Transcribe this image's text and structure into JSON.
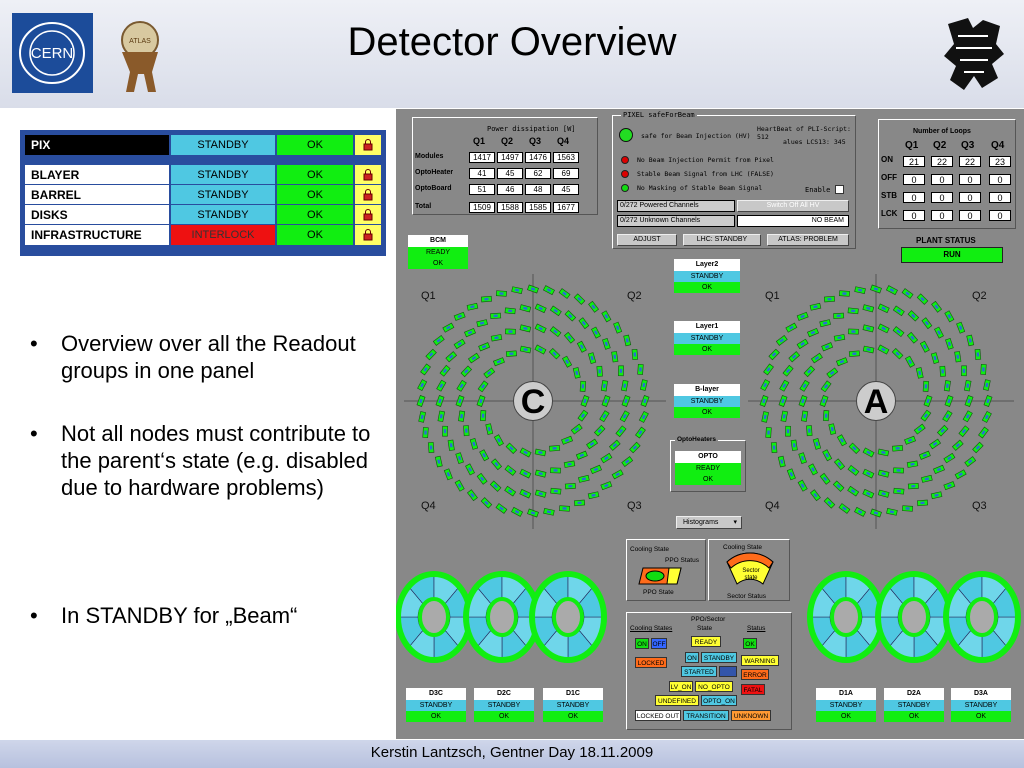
{
  "header": {
    "title": "Detector Overview",
    "cern_logo_text": "CERN",
    "atlas_logo_text": "ATLAS"
  },
  "footer": {
    "text": "Kerstin Lantzsch, Gentner Day 18.11.2009"
  },
  "status_table": {
    "rows": [
      {
        "name": "PIX",
        "state": "STANDBY",
        "status": "OK",
        "lock": "lock-icon"
      },
      {
        "name": "BLAYER",
        "state": "STANDBY",
        "status": "OK",
        "lock": "lock-icon"
      },
      {
        "name": "BARREL",
        "state": "STANDBY",
        "status": "OK",
        "lock": "lock-icon"
      },
      {
        "name": "DISKS",
        "state": "STANDBY",
        "status": "OK",
        "lock": "lock-icon"
      },
      {
        "name": "INFRASTRUCTURE",
        "state": "INTERLOCK",
        "status": "OK",
        "lock": "lock-icon"
      }
    ],
    "colors": {
      "border": "#294d9e",
      "standby": "#4fc8e2",
      "ok": "#11ee11",
      "interlock": "#ee1111",
      "lock": "#ffff66"
    }
  },
  "bullets": [
    "Overview over all the Readout groups in one panel",
    "Not all nodes must contribute to the parent‘s state (e.g. disabled due to hardware problems)",
    "In STANDBY for „Beam“"
  ],
  "power": {
    "title": "Power dissipation [W]",
    "cols": [
      "Q1",
      "Q2",
      "Q3",
      "Q4"
    ],
    "rows": [
      {
        "label": "Modules",
        "values": [
          "1417",
          "1497",
          "1476",
          "1563"
        ]
      },
      {
        "label": "OptoHeater",
        "values": [
          "41",
          "45",
          "62",
          "69"
        ]
      },
      {
        "label": "OptoBoard",
        "values": [
          "51",
          "46",
          "48",
          "45"
        ]
      },
      {
        "label": "Total",
        "values": [
          "1509",
          "1588",
          "1585",
          "1677"
        ]
      }
    ]
  },
  "safe_for_beam": {
    "title": "PIXEL safeForBeam",
    "injection_label": "safe for Beam Injection (HV)",
    "heartbeat": "HeartBeat of PLI-Script: 512",
    "alues": "alues LCS13:  345",
    "signals": [
      {
        "text": "No Beam Injection Permit from Pixel",
        "color": "#dd0000"
      },
      {
        "text": "Stable Beam Signal from LHC (FALSE)",
        "color": "#dd0000"
      },
      {
        "text": "No Masking of Stable Beam Signal",
        "color": "#11dd11"
      }
    ],
    "enable_label": "Enable",
    "powered": "0/272 Powered Channels",
    "unknown": "0/272 Unknown Channels",
    "switch_off": "Switch Off All HV",
    "no_beam": "NO BEAM",
    "buttons": [
      "ADJUST",
      "LHC: STANDBY",
      "ATLAS: PROBLEM"
    ]
  },
  "loops": {
    "title": "Number of Loops",
    "cols": [
      "Q1",
      "Q2",
      "Q3",
      "Q4"
    ],
    "rows": [
      {
        "label": "ON",
        "values": [
          "21",
          "22",
          "22",
          "23"
        ]
      },
      {
        "label": "OFF",
        "values": [
          "0",
          "0",
          "0",
          "0"
        ]
      },
      {
        "label": "STB",
        "values": [
          "0",
          "0",
          "0",
          "0"
        ]
      },
      {
        "label": "LCK",
        "values": [
          "0",
          "0",
          "0",
          "0"
        ]
      }
    ]
  },
  "plant": {
    "title": "PLANT STATUS",
    "value": "RUN"
  },
  "bcm": {
    "title": "BCM",
    "state": "READY",
    "status": "OK"
  },
  "layers": [
    {
      "title": "Layer2",
      "state": "STANDBY",
      "status": "OK"
    },
    {
      "title": "Layer1",
      "state": "STANDBY",
      "status": "OK"
    },
    {
      "title": "B-layer",
      "state": "STANDBY",
      "status": "OK"
    }
  ],
  "opto": {
    "group": "OptoHeaters",
    "title": "OPTO",
    "state": "READY",
    "status": "OK"
  },
  "histograms": "Histograms",
  "side_c": {
    "letter": "C",
    "quadrants": [
      "Q1",
      "Q2",
      "Q4",
      "Q3"
    ]
  },
  "side_a": {
    "letter": "A",
    "quadrants": [
      "Q1",
      "Q2",
      "Q4",
      "Q3"
    ]
  },
  "cooling": {
    "left_title": "Cooling State",
    "ppo_status": "PPO Status",
    "ppo_state": "PPO State",
    "right_title": "Cooling State",
    "sector_state": "Sector state",
    "sector_status": "Sector Status"
  },
  "legend": {
    "title": "PPO/Sector",
    "cooling_states": "Cooling States",
    "state": "State",
    "status": "Status",
    "tags": {
      "on": "ON",
      "off": "OFF",
      "locked": "LOCKED",
      "ready": "READY",
      "on2": "ON",
      "standby": "STANDBY",
      "started": "STARTED",
      "lv_on": "LV_ON",
      "no_opto": "NO_OPTO",
      "undefined": "UNDEFINED",
      "opto_on": "OPTO_ON",
      "locked_out": "LOCKED OUT",
      "transition": "TRANSITION",
      "unknown": "UNKNOWN",
      "ok": "OK",
      "warning": "WARNING",
      "error": "ERROR",
      "fatal": "FATAL"
    }
  },
  "disks": [
    {
      "title": "D3C",
      "state": "STANDBY",
      "status": "OK"
    },
    {
      "title": "D2C",
      "state": "STANDBY",
      "status": "OK"
    },
    {
      "title": "D1C",
      "state": "STANDBY",
      "status": "OK"
    },
    {
      "title": "D1A",
      "state": "STANDBY",
      "status": "OK"
    },
    {
      "title": "D2A",
      "state": "STANDBY",
      "status": "OK"
    },
    {
      "title": "D3A",
      "state": "STANDBY",
      "status": "OK"
    }
  ]
}
